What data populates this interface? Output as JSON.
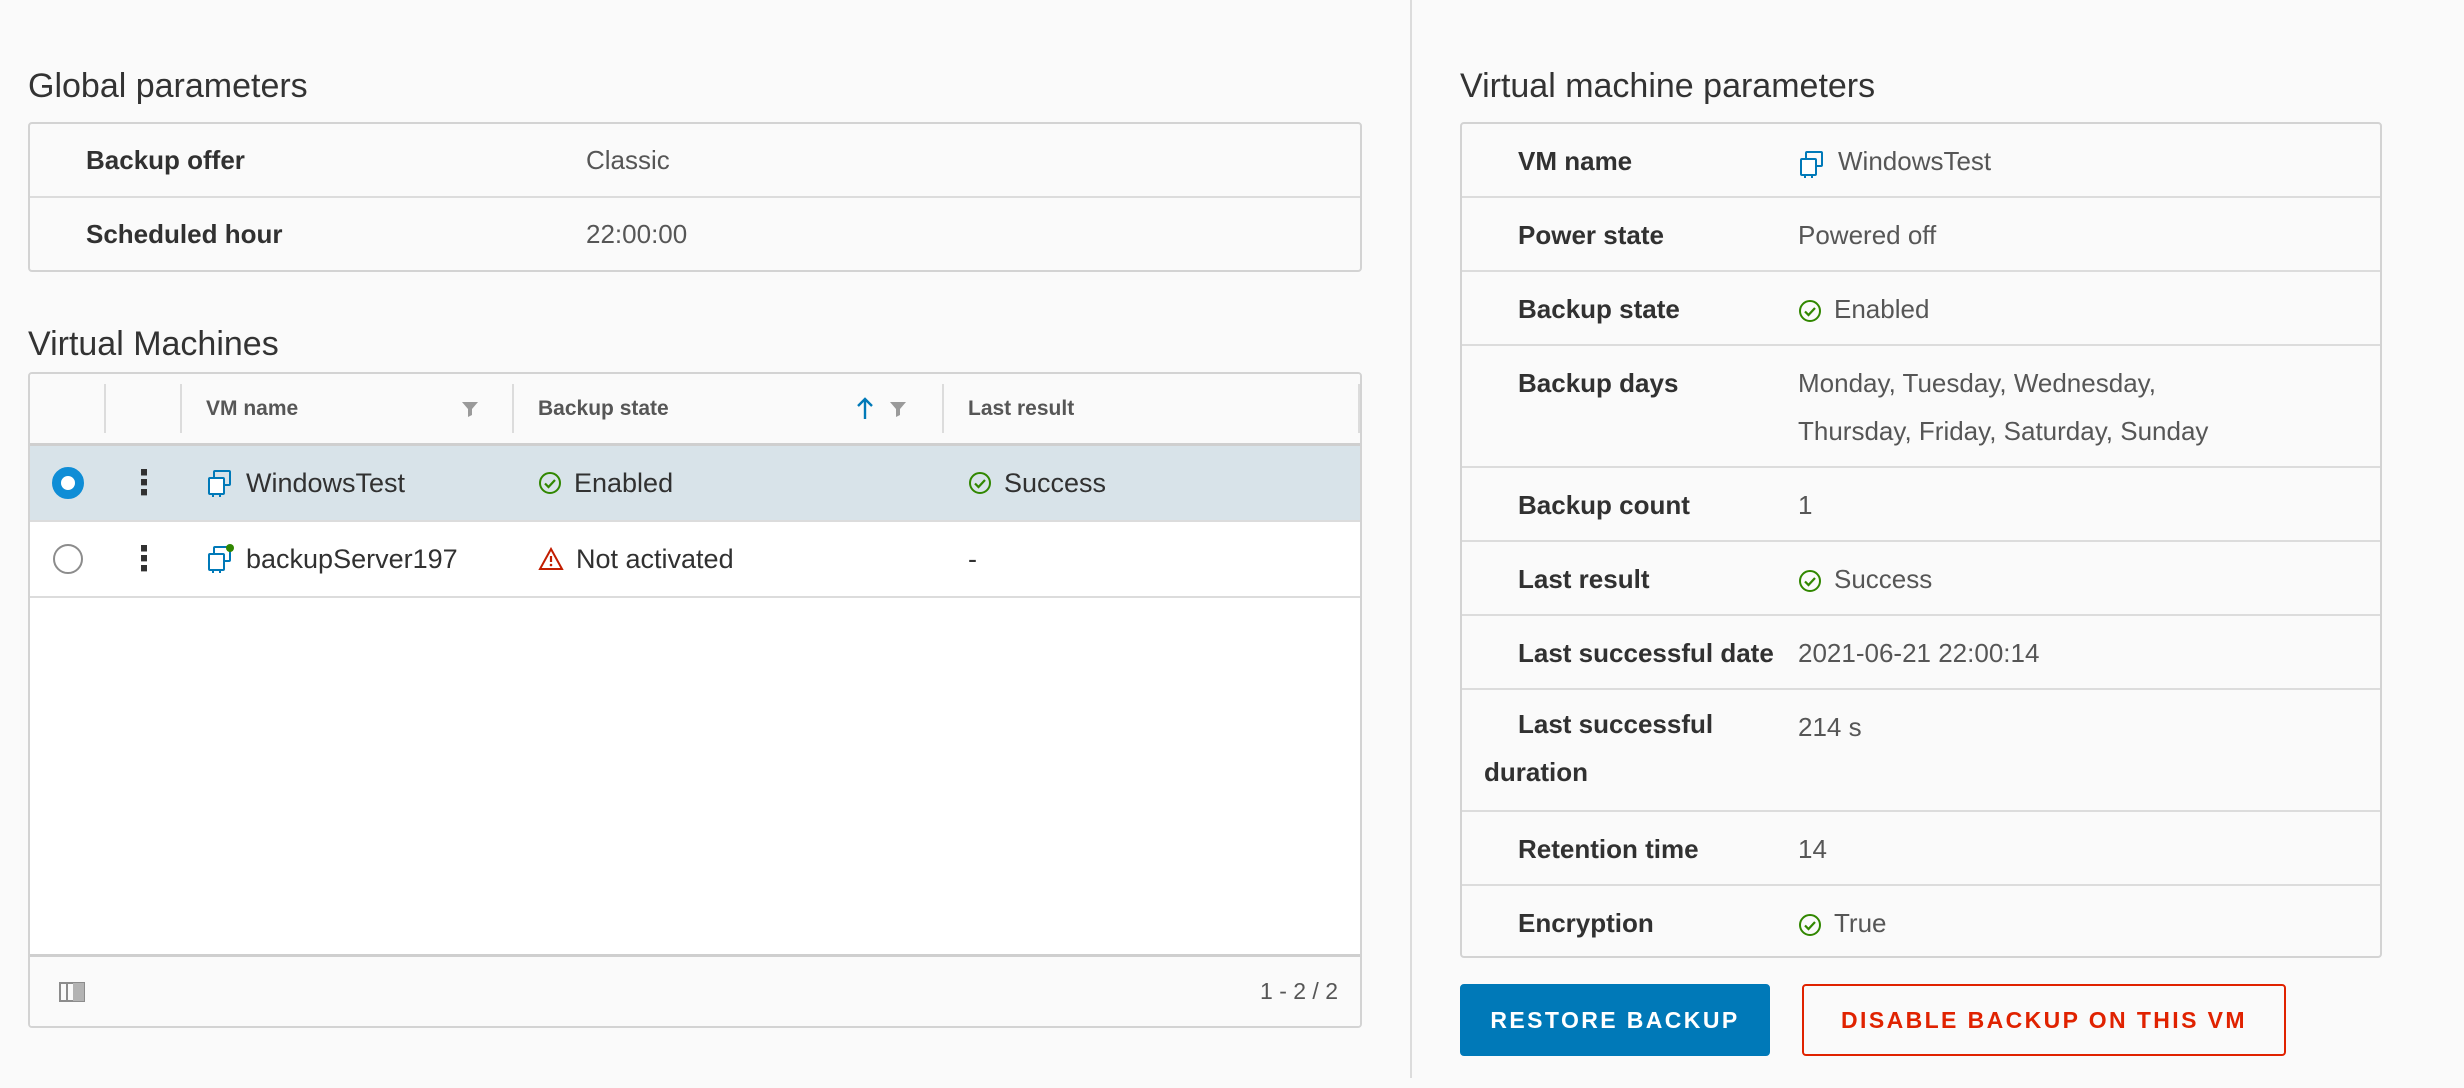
{
  "global_parameters": {
    "title": "Global parameters",
    "rows": [
      {
        "label": "Backup offer",
        "value": "Classic"
      },
      {
        "label": "Scheduled hour",
        "value": "22:00:00"
      }
    ]
  },
  "virtual_machines": {
    "title": "Virtual Machines",
    "columns": {
      "name": "VM name",
      "state": "Backup state",
      "result": "Last result"
    },
    "rows": [
      {
        "name": "WindowsTest",
        "state": "Enabled",
        "result": "Success",
        "selected": true
      },
      {
        "name": "backupServer197",
        "state": "Not activated",
        "result": "-",
        "selected": false
      }
    ],
    "pagination": "1 - 2 / 2"
  },
  "vm_parameters": {
    "title": "Virtual machine parameters",
    "vm_name_label": "VM name",
    "vm_name": "WindowsTest",
    "power_state_label": "Power state",
    "power_state": "Powered off",
    "backup_state_label": "Backup state",
    "backup_state": "Enabled",
    "backup_days_label": "Backup days",
    "backup_days_line1": "Monday, Tuesday, Wednesday,",
    "backup_days_line2": "Thursday, Friday, Saturday, Sunday",
    "backup_count_label": "Backup count",
    "backup_count": "1",
    "last_result_label": "Last result",
    "last_result": "Success",
    "last_date_label": "Last successful date",
    "last_date": "2021-06-21 22:00:14",
    "last_duration_label": "Last successful duration",
    "last_duration": "214 s",
    "retention_label": "Retention time",
    "retention": "14",
    "encryption_label": "Encryption",
    "encryption": "True"
  },
  "actions": {
    "restore": "RESTORE BACKUP",
    "disable": "DISABLE BACKUP ON THIS VM"
  },
  "colors": {
    "primary": "#0079b8",
    "danger": "#e02200",
    "success": "#318700",
    "warning": "#c21d00",
    "selected_row": "#d8e3e9"
  }
}
